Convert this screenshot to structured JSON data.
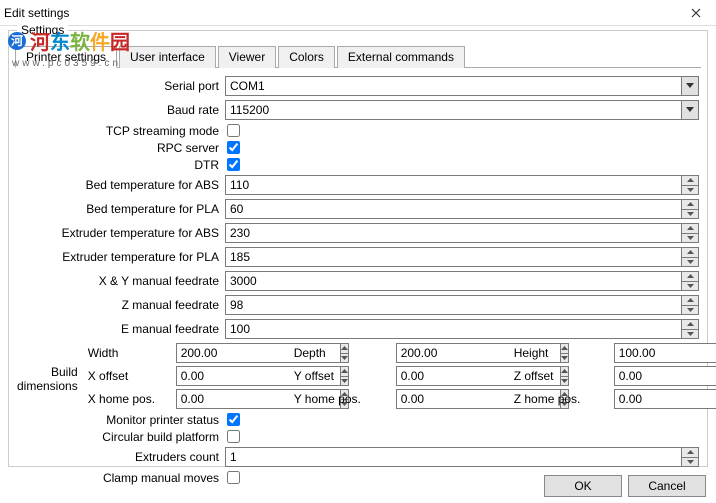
{
  "window": {
    "title": "Edit settings"
  },
  "groupbox": {
    "legend": "Settings"
  },
  "tabs": [
    "Printer settings",
    "User interface",
    "Viewer",
    "Colors",
    "External commands"
  ],
  "active_tab": 0,
  "labels": {
    "serial_port": "Serial port",
    "baud_rate": "Baud rate",
    "tcp_streaming": "TCP streaming mode",
    "rpc_server": "RPC server",
    "dtr": "DTR",
    "bed_abs": "Bed temperature for ABS",
    "bed_pla": "Bed temperature for PLA",
    "ext_abs": "Extruder temperature for ABS",
    "ext_pla": "Extruder temperature for PLA",
    "xy_feed": "X & Y manual feedrate",
    "z_feed": "Z manual feedrate",
    "e_feed": "E manual feedrate",
    "build_dim": "Build dimensions",
    "width": "Width",
    "depth": "Depth",
    "height": "Height",
    "x_offset": "X offset",
    "y_offset": "Y offset",
    "z_offset": "Z offset",
    "x_home": "X home pos.",
    "y_home": "Y home pos.",
    "z_home": "Z home pos.",
    "monitor": "Monitor printer status",
    "circular": "Circular build platform",
    "extruders": "Extruders count",
    "clamp": "Clamp manual moves"
  },
  "values": {
    "serial_port": "COM1",
    "baud_rate": "115200",
    "tcp_streaming": false,
    "rpc_server": true,
    "dtr": true,
    "bed_abs": "110",
    "bed_pla": "60",
    "ext_abs": "230",
    "ext_pla": "185",
    "xy_feed": "3000",
    "z_feed": "98",
    "e_feed": "100",
    "width": "200.00",
    "depth": "200.00",
    "height": "100.00",
    "x_offset": "0.00",
    "y_offset": "0.00",
    "z_offset": "0.00",
    "x_home": "0.00",
    "y_home": "0.00",
    "z_home": "0.00",
    "monitor": true,
    "circular": false,
    "extruders": "1",
    "clamp": false
  },
  "buttons": {
    "ok": "OK",
    "cancel": "Cancel"
  },
  "watermark": {
    "text": "河东软件园",
    "url": "www.pc0359.cn"
  }
}
